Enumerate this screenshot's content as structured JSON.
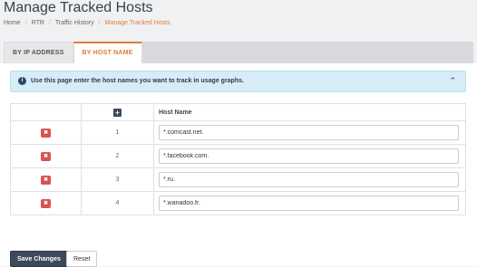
{
  "page": {
    "title": "Manage Tracked Hosts"
  },
  "breadcrumb": [
    "Home",
    "RTR",
    "Traffic History",
    "Manage Tracked Hosts"
  ],
  "tabs": [
    {
      "label": "BY IP ADDRESS",
      "active": false
    },
    {
      "label": "BY HOST NAME",
      "active": true
    }
  ],
  "alert": {
    "message": "Use this page enter the host names you want to track in usage graphs.",
    "icon": "info-icon",
    "toggle_icon": "chevron-up-icon"
  },
  "table": {
    "header": {
      "add_icon": "plus-icon",
      "host_col": "Host Name"
    },
    "rows": [
      {
        "index": "1",
        "host": "*.comcast.net."
      },
      {
        "index": "2",
        "host": "*.facebook.com."
      },
      {
        "index": "3",
        "host": "*.ru."
      },
      {
        "index": "4",
        "host": "*.wanadoo.fr."
      }
    ]
  },
  "actions": {
    "save_label": "Save Changes",
    "reset_label": "Reset"
  },
  "colors": {
    "accent": "#e07b39",
    "dark": "#3c4a5a",
    "danger": "#d9534f",
    "alert_bg": "#d6ecf6"
  }
}
